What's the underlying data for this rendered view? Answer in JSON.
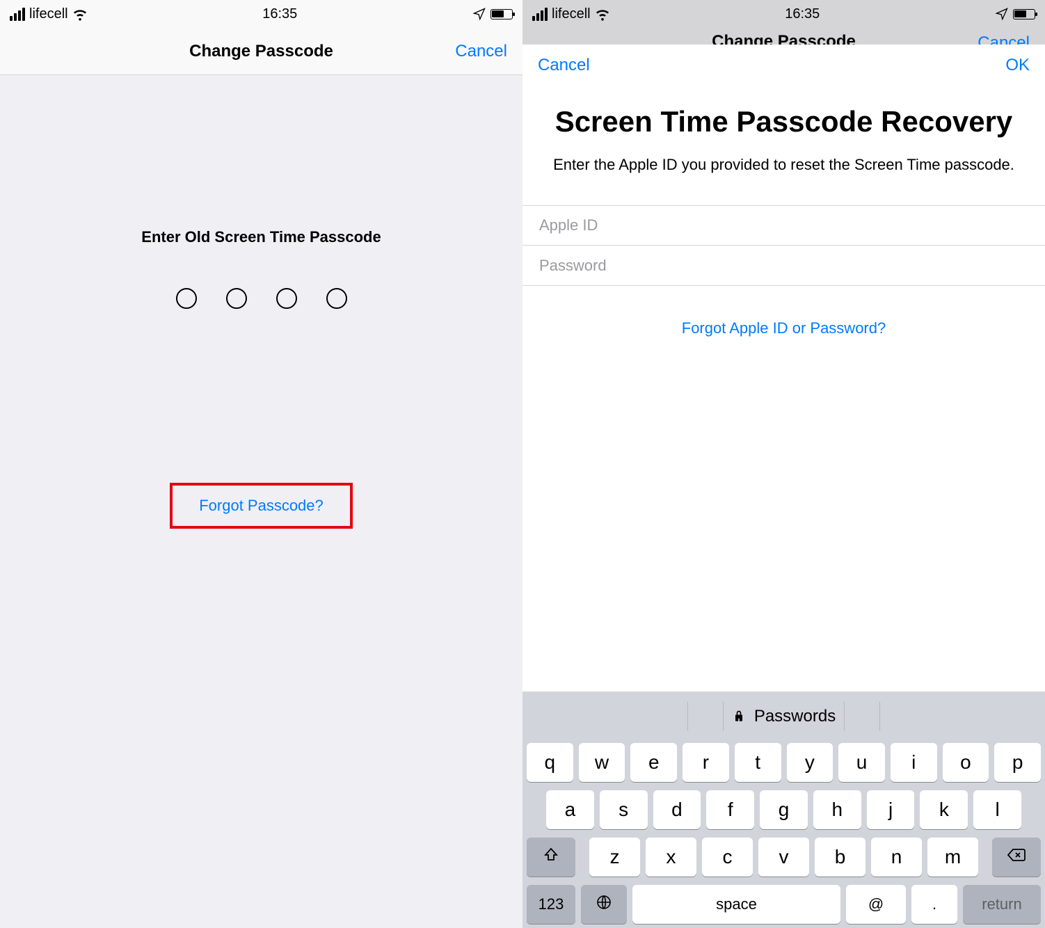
{
  "statusbar": {
    "carrier": "lifecell",
    "time": "16:35"
  },
  "left": {
    "title": "Change Passcode",
    "cancel": "Cancel",
    "prompt": "Enter Old Screen Time Passcode",
    "forgot": "Forgot Passcode?"
  },
  "right": {
    "hidden_title": "Change Passcode",
    "hidden_cancel": "Cancel",
    "cancel": "Cancel",
    "ok": "OK",
    "title": "Screen Time Passcode Recovery",
    "subtitle": "Enter the Apple ID you provided to reset the Screen Time passcode.",
    "apple_id_placeholder": "Apple ID",
    "password_placeholder": "Password",
    "forgot": "Forgot Apple ID or Password?"
  },
  "keyboard": {
    "suggestion": "Passwords",
    "row1": [
      "q",
      "w",
      "e",
      "r",
      "t",
      "y",
      "u",
      "i",
      "o",
      "p"
    ],
    "row2": [
      "a",
      "s",
      "d",
      "f",
      "g",
      "h",
      "j",
      "k",
      "l"
    ],
    "row3": [
      "z",
      "x",
      "c",
      "v",
      "b",
      "n",
      "m"
    ],
    "num": "123",
    "space": "space",
    "at": "@",
    "dot": ".",
    "return": "return"
  }
}
